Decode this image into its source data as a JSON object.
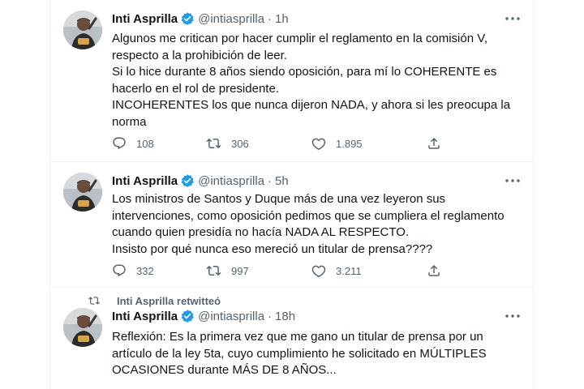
{
  "colors": {
    "verified": "#1d9bf0",
    "icon": "#536471",
    "text": "#0f1419",
    "divider": "#eff3f4"
  },
  "icons": {
    "reply": "reply-icon",
    "retweet": "retweet-icon",
    "like": "heart-icon",
    "share": "share-icon",
    "more": "more-icon",
    "verified": "verified-badge-icon"
  },
  "tweets": [
    {
      "name": "Inti Asprilla",
      "handle": "@intiasprilla",
      "dot": "·",
      "time": "1h",
      "text": "Algunos me critican por hacer cumplir el reglamento en la comisión V, respecto a la prohibición de leer.\nSi lo hice durante 8 años siendo oposición, para mí lo COHERENTE es hacerlo en el rol de presidente.\nINCOHERENTES los que nunca dijeron NADA, y ahora si les preocupa la norma",
      "replies": "108",
      "retweets": "306",
      "likes": "1.895"
    },
    {
      "name": "Inti Asprilla",
      "handle": "@intiasprilla",
      "dot": "·",
      "time": "5h",
      "text": "Los ministros de Santos y Duque más de una vez leyeron sus intervenciones, como oposición pedimos que se cumpliera el reglamento cuando quien presidía no hacía NADA AL RESPECTO.\nInsisto por qué nunca eso mereció un titular de prensa????",
      "replies": "332",
      "retweets": "997",
      "likes": "3.211"
    },
    {
      "retweeted_by": "Inti Asprilla retwitteó",
      "name": "Inti Asprilla",
      "handle": "@intiasprilla",
      "dot": "·",
      "time": "18h",
      "text": "Reflexión: Es la primera vez que me gano un titular de prensa por un artículo de la ley 5ta, cuyo cumplimiento he solicitado en MÚLTIPLES OCASIONES durante MÁS DE 8 AÑOS..."
    }
  ]
}
